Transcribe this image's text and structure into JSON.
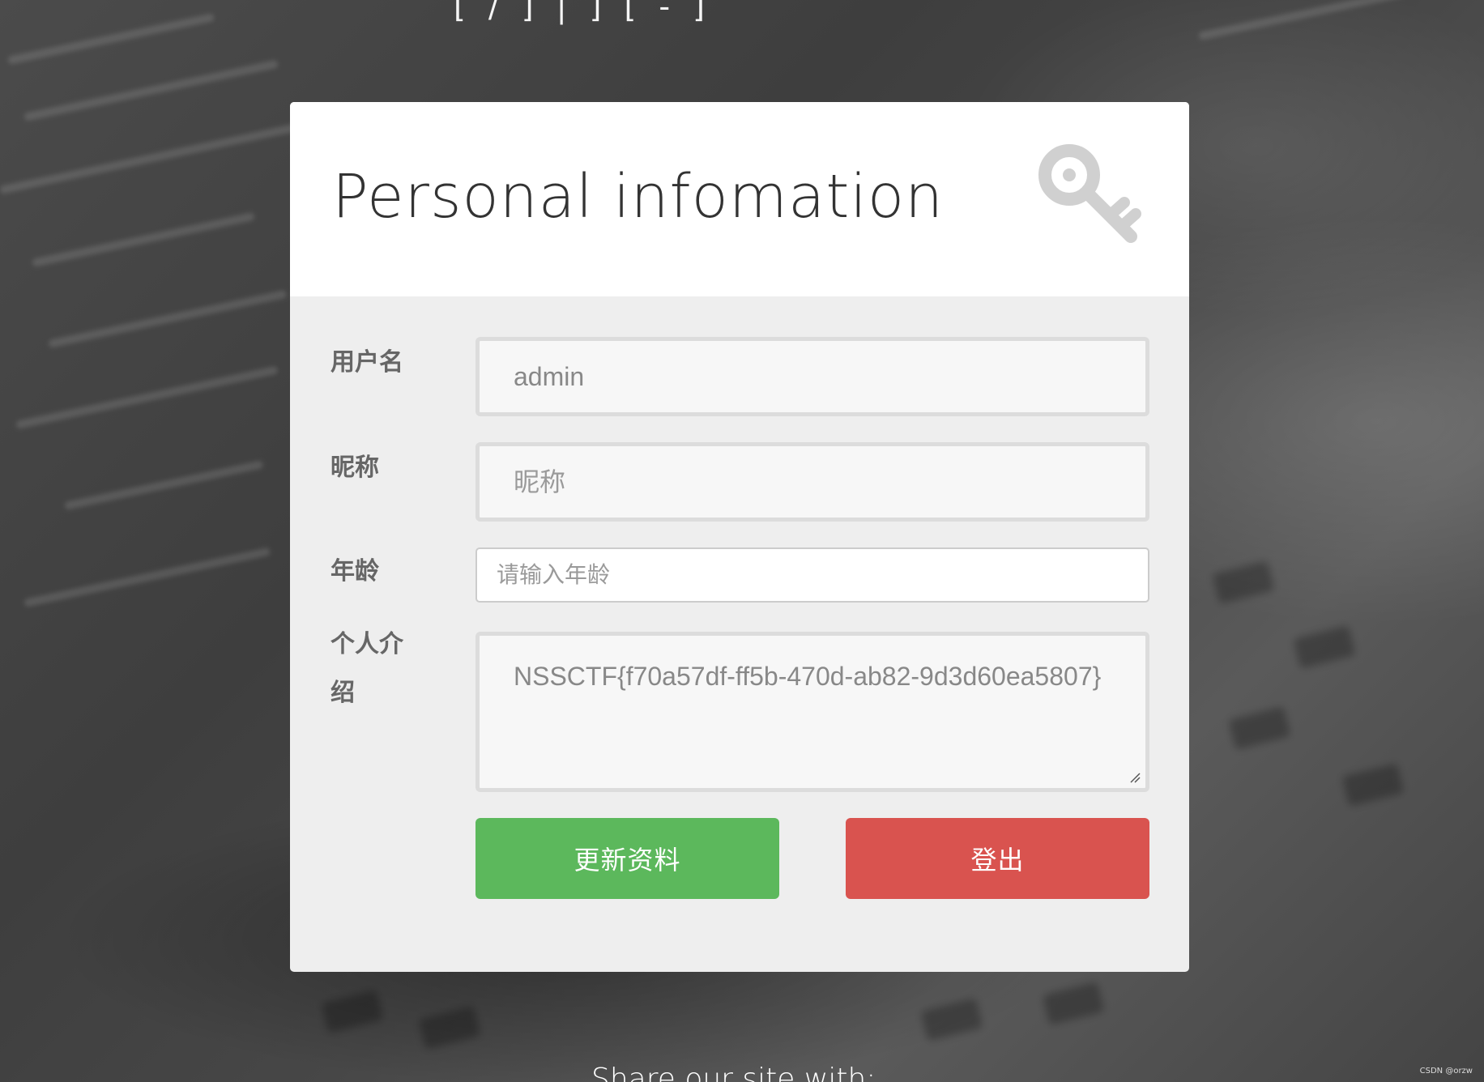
{
  "page": {
    "top_title_fragment": "[ / ] | ] [ - ]",
    "share_text": "Share our site with:",
    "watermark": "CSDN @orzw"
  },
  "card": {
    "title": "Personal infomation",
    "header_icon": "key-icon"
  },
  "form": {
    "username": {
      "label": "用户名",
      "value": "admin",
      "placeholder": ""
    },
    "nickname": {
      "label": "昵称",
      "value": "",
      "placeholder": "昵称"
    },
    "age": {
      "label": "年龄",
      "value": "",
      "placeholder": "请输入年龄"
    },
    "bio": {
      "label": "个人介绍",
      "value": "NSSCTF{f70a57df-ff5b-470d-ab82-9d3d60ea5807}"
    }
  },
  "buttons": {
    "update_label": "更新资料",
    "logout_label": "登出"
  },
  "colors": {
    "update": "#5cb85c",
    "logout": "#d9534f",
    "card_body": "#eeeeee",
    "card_header": "#ffffff"
  }
}
